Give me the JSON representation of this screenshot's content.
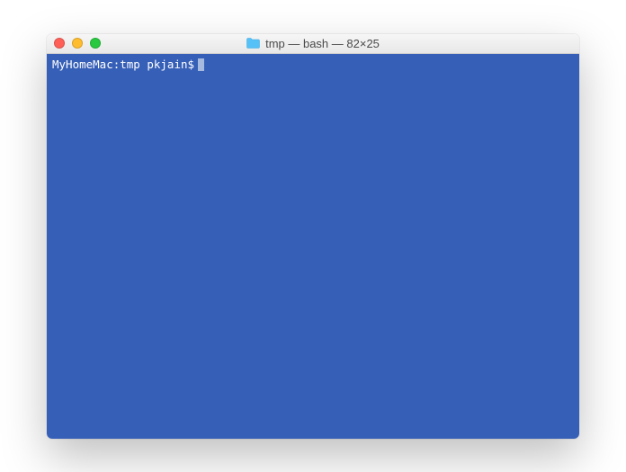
{
  "window": {
    "title": "tmp — bash — 82×25"
  },
  "terminal": {
    "prompt": "MyHomeMac:tmp pkjain$"
  },
  "icons": {
    "folder": "folder-icon",
    "close": "close-window",
    "minimize": "minimize-window",
    "maximize": "maximize-window"
  }
}
